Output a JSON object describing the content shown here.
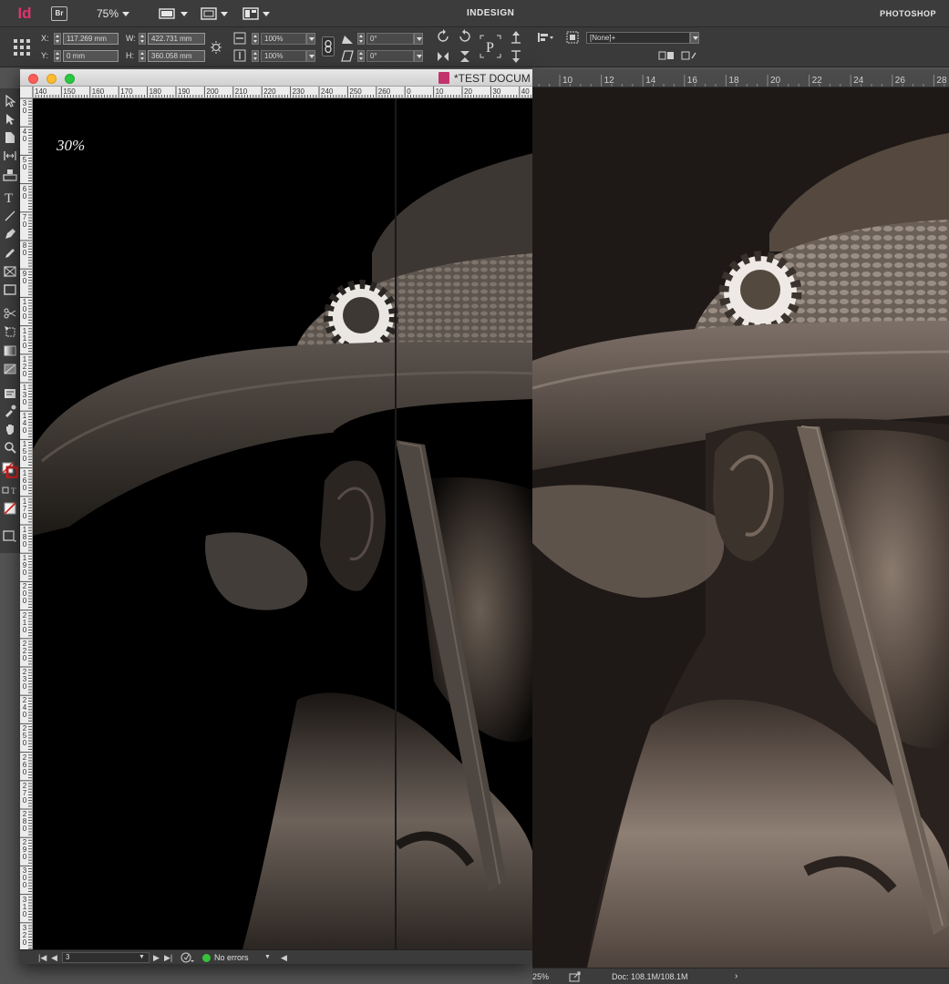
{
  "appbar": {
    "logo": "Id",
    "bridge": "Br",
    "zoom": "75%",
    "workspace_indesign": "INDESIGN",
    "workspace_photoshop": "PHOTOSHOP"
  },
  "control": {
    "x_label": "X:",
    "x_value": "117.269 mm",
    "y_label": "Y:",
    "y_value": "0 mm",
    "w_label": "W:",
    "w_value": "422.731 mm",
    "h_label": "H:",
    "h_value": "360.058 mm",
    "scale_x": "100%",
    "scale_y": "100%",
    "rotate": "0°",
    "shear": "0°",
    "object_style": "[None]+"
  },
  "id_document": {
    "title": "*TEST DOCUM",
    "overlay_text": "30%",
    "hruler_labels": [
      "140",
      "150",
      "160",
      "170",
      "180",
      "190",
      "200",
      "210",
      "220",
      "230",
      "240",
      "250",
      "260",
      "0",
      "10",
      "20",
      "30",
      "40"
    ],
    "vruler_labels": [
      "30",
      "40",
      "50",
      "60",
      "70",
      "80",
      "90",
      "100",
      "110",
      "120",
      "130",
      "140",
      "150",
      "160",
      "170",
      "180",
      "190",
      "200",
      "210",
      "220",
      "230",
      "240",
      "250",
      "260",
      "270",
      "280",
      "290",
      "300",
      "310",
      "320"
    ],
    "page_number": "3",
    "preflight_status": "No errors"
  },
  "ps_document": {
    "ruler_labels": [
      "10",
      "12",
      "14",
      "16",
      "18",
      "20",
      "22",
      "24",
      "26",
      "28"
    ],
    "zoom": "25%",
    "doc_size": "Doc: 108.1M/108.1M",
    "status_arrow": "›"
  },
  "colors": {
    "indesign_brand": "#e0336e",
    "preflight_ok": "#37c23a",
    "mac_close": "#fc5f57",
    "mac_minimize": "#fdbc2e",
    "mac_zoom": "#29c840"
  }
}
